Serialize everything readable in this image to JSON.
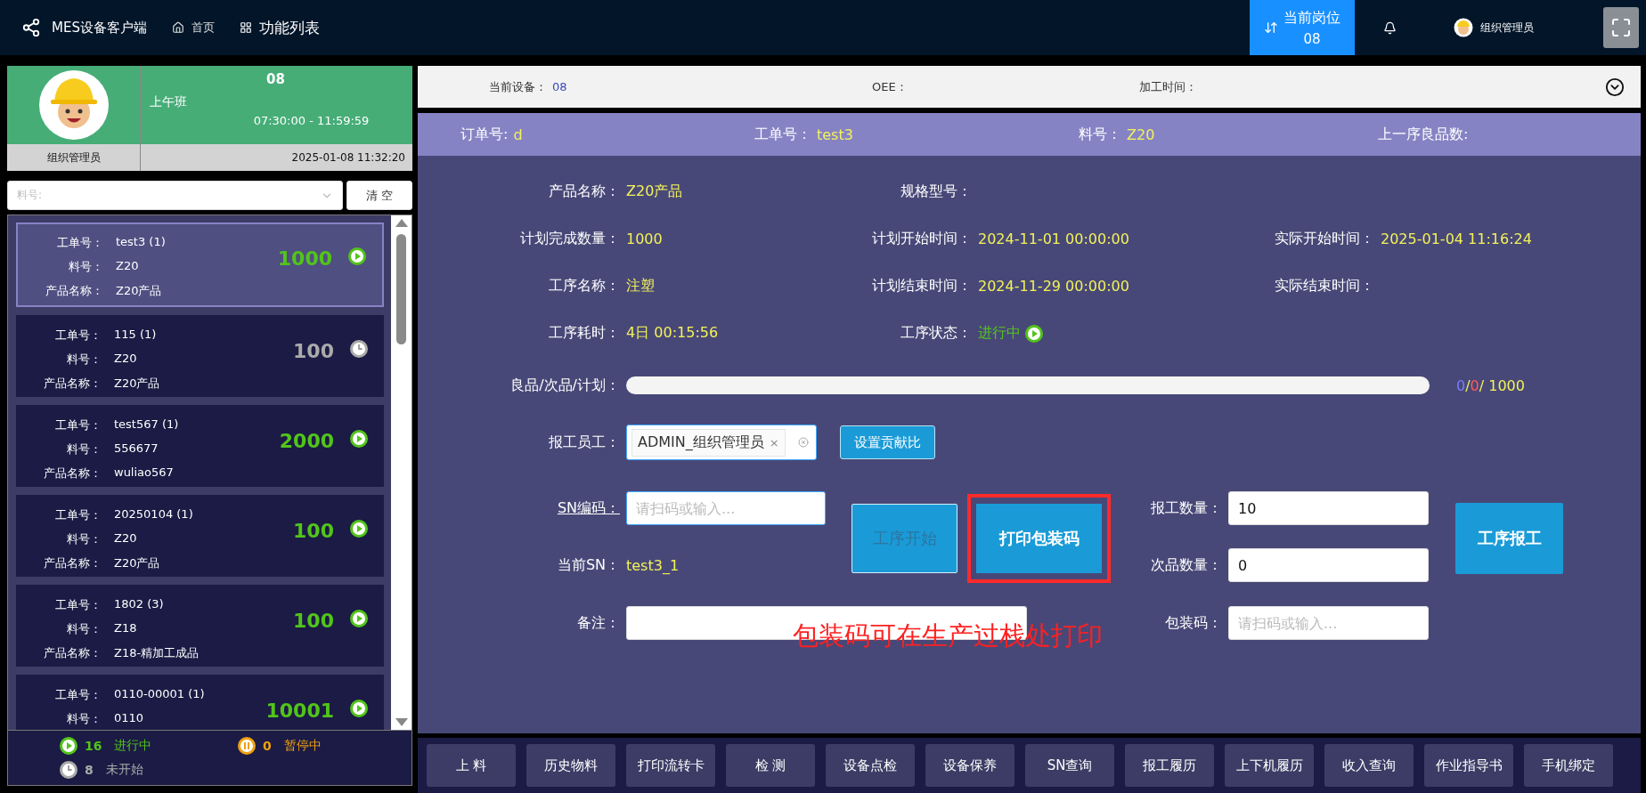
{
  "header": {
    "app_title": "MES设备客户端",
    "nav": [
      {
        "label": "首页",
        "kind": "home",
        "selected": false
      },
      {
        "label": "功能列表",
        "kind": "grid",
        "selected": true
      }
    ],
    "station": {
      "label": "当前岗位",
      "value": "08",
      "selected": true
    },
    "user": "组织管理员"
  },
  "shift": {
    "station": "08",
    "name": "上午班",
    "time": "07:30:00 - 11:59:59",
    "user": "组织管理员",
    "datetime": "2025-01-08 11:32:20"
  },
  "filter": {
    "placeholder": "料号:",
    "clear_button": "清 空"
  },
  "work_orders": [
    {
      "fields": [
        {
          "label": "工单号：",
          "value": "test3 (1)"
        },
        {
          "label": "料号：",
          "value": "Z20"
        },
        {
          "label": "产品名称：",
          "value": "Z20产品"
        }
      ],
      "quantity": "1000",
      "kind": "running",
      "selected": true
    },
    {
      "fields": [
        {
          "label": "工单号：",
          "value": "115 (1)"
        },
        {
          "label": "料号：",
          "value": "Z20"
        },
        {
          "label": "产品名称：",
          "value": "Z20产品"
        }
      ],
      "quantity": "100",
      "kind": "waiting",
      "selected": false
    },
    {
      "fields": [
        {
          "label": "工单号：",
          "value": "test567 (1)"
        },
        {
          "label": "料号：",
          "value": "556677"
        },
        {
          "label": "产品名称：",
          "value": "wuliao567"
        }
      ],
      "quantity": "2000",
      "kind": "running",
      "selected": false
    },
    {
      "fields": [
        {
          "label": "工单号：",
          "value": "20250104 (1)"
        },
        {
          "label": "料号：",
          "value": "Z20"
        },
        {
          "label": "产品名称：",
          "value": "Z20产品"
        }
      ],
      "quantity": "100",
      "kind": "running",
      "selected": false
    },
    {
      "fields": [
        {
          "label": "工单号：",
          "value": "1802 (3)"
        },
        {
          "label": "料号：",
          "value": "Z18"
        },
        {
          "label": "产品名称：",
          "value": "Z18-精加工成品"
        }
      ],
      "quantity": "100",
      "kind": "running",
      "selected": false
    },
    {
      "fields": [
        {
          "label": "工单号：",
          "value": "0110-00001 (1)"
        },
        {
          "label": "料号：",
          "value": "0110"
        }
      ],
      "quantity": "10001",
      "kind": "running",
      "selected": false
    }
  ],
  "summary": [
    {
      "kind": "running",
      "count": "16",
      "label": "进行中"
    },
    {
      "kind": "paused",
      "count": "0",
      "label": "暂停中"
    },
    {
      "kind": "waiting",
      "count": "8",
      "label": "未开始"
    }
  ],
  "device_bar": [
    {
      "label": "当前设备：",
      "value": "08"
    },
    {
      "label": "OEE："
    },
    {
      "label": "加工时间："
    }
  ],
  "order_bar": [
    {
      "label": "订单号:",
      "value": "d"
    },
    {
      "label": "工单号：",
      "value": "test3"
    },
    {
      "label": "料号：",
      "value": "Z20"
    },
    {
      "label": "上一序良品数:"
    }
  ],
  "details": [
    [
      {
        "label": "产品名称：",
        "value": "Z20产品"
      },
      {
        "label": "规格型号："
      }
    ],
    [
      {
        "label": "计划完成数量：",
        "value": "1000"
      },
      {
        "label": "计划开始时间：",
        "value": "2024-11-01 00:00:00"
      },
      {
        "label": "实际开始时间：",
        "value": "2025-01-04 11:16:24"
      }
    ],
    [
      {
        "label": "工序名称：",
        "value": "注塑"
      },
      {
        "label": "计划结束时间：",
        "value": "2024-11-29 00:00:00"
      },
      {
        "label": "实际结束时间："
      }
    ],
    [
      {
        "label": "工序耗时：",
        "value": "4日 00:15:56"
      },
      {
        "label": "工序状态：",
        "value": "进行中",
        "kind": "status"
      }
    ]
  ],
  "progress": {
    "label": "良品/次品/计划：",
    "level": 0,
    "reading": [
      {
        "kind": "good",
        "text": "0"
      },
      {
        "kind": "plain",
        "text": "/"
      },
      {
        "kind": "bad",
        "text": "0"
      },
      {
        "kind": "plain",
        "text": "/ 1000"
      }
    ]
  },
  "staff": {
    "label": "报工员工：",
    "tags": [
      {
        "text": "ADMIN_组织管理员",
        "remove": "×"
      }
    ],
    "button": "设置贡献比"
  },
  "sn": {
    "label": "SN编码：",
    "placeholder": "请扫码或输入...",
    "focused": true
  },
  "current_sn": {
    "label": "当前SN：",
    "value": "test3_1"
  },
  "remark": {
    "label": "备注："
  },
  "start_button": {
    "label": "工序开始",
    "disabled": true
  },
  "print_button": {
    "label": "打印包装码",
    "highlighted": true
  },
  "report_qty": {
    "label": "报工数量：",
    "value": "10"
  },
  "defect_qty": {
    "label": "次品数量：",
    "value": "0"
  },
  "package_code": {
    "label": "包装码：",
    "placeholder": "请扫码或输入..."
  },
  "report_button": "工序报工",
  "annotation": "包装码可在生产过栈处打印",
  "toolbar": [
    "上 料",
    "历史物料",
    "打印流转卡",
    "检 测",
    "设备点检",
    "设备保养",
    "SN查询",
    "报工履历",
    "上下机履历",
    "收入查询",
    "作业指导书",
    "手机绑定"
  ]
}
